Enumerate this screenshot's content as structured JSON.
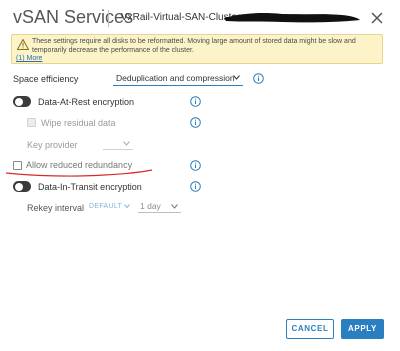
{
  "dialog": {
    "title": "vSAN Services",
    "cluster_name": "VxRail-Virtual-SAN-Cluster-"
  },
  "warning": {
    "message": "These settings require all disks to be reformatted. Moving large amount of stored data might be slow and temporarily decrease the performance of the cluster.",
    "more_link": "(1) More"
  },
  "space_efficiency": {
    "label": "Space efficiency",
    "value": "Deduplication and compression"
  },
  "data_at_rest": {
    "label": "Data-At-Rest encryption",
    "enabled": false,
    "wipe_label": "Wipe residual data",
    "key_provider_label": "Key provider"
  },
  "allow_reduced_redundancy": {
    "label": "Allow reduced redundancy",
    "checked": false
  },
  "data_in_transit": {
    "label": "Data-In-Transit encryption",
    "enabled": false,
    "rekey_label": "Rekey interval",
    "default_link": "DEFAULT",
    "interval_value": "1 day"
  },
  "buttons": {
    "cancel": "CANCEL",
    "apply": "APPLY"
  },
  "colors": {
    "accent": "#2a7fc1",
    "warning_bg": "#fdf3c8",
    "annotation": "#d8282b"
  }
}
